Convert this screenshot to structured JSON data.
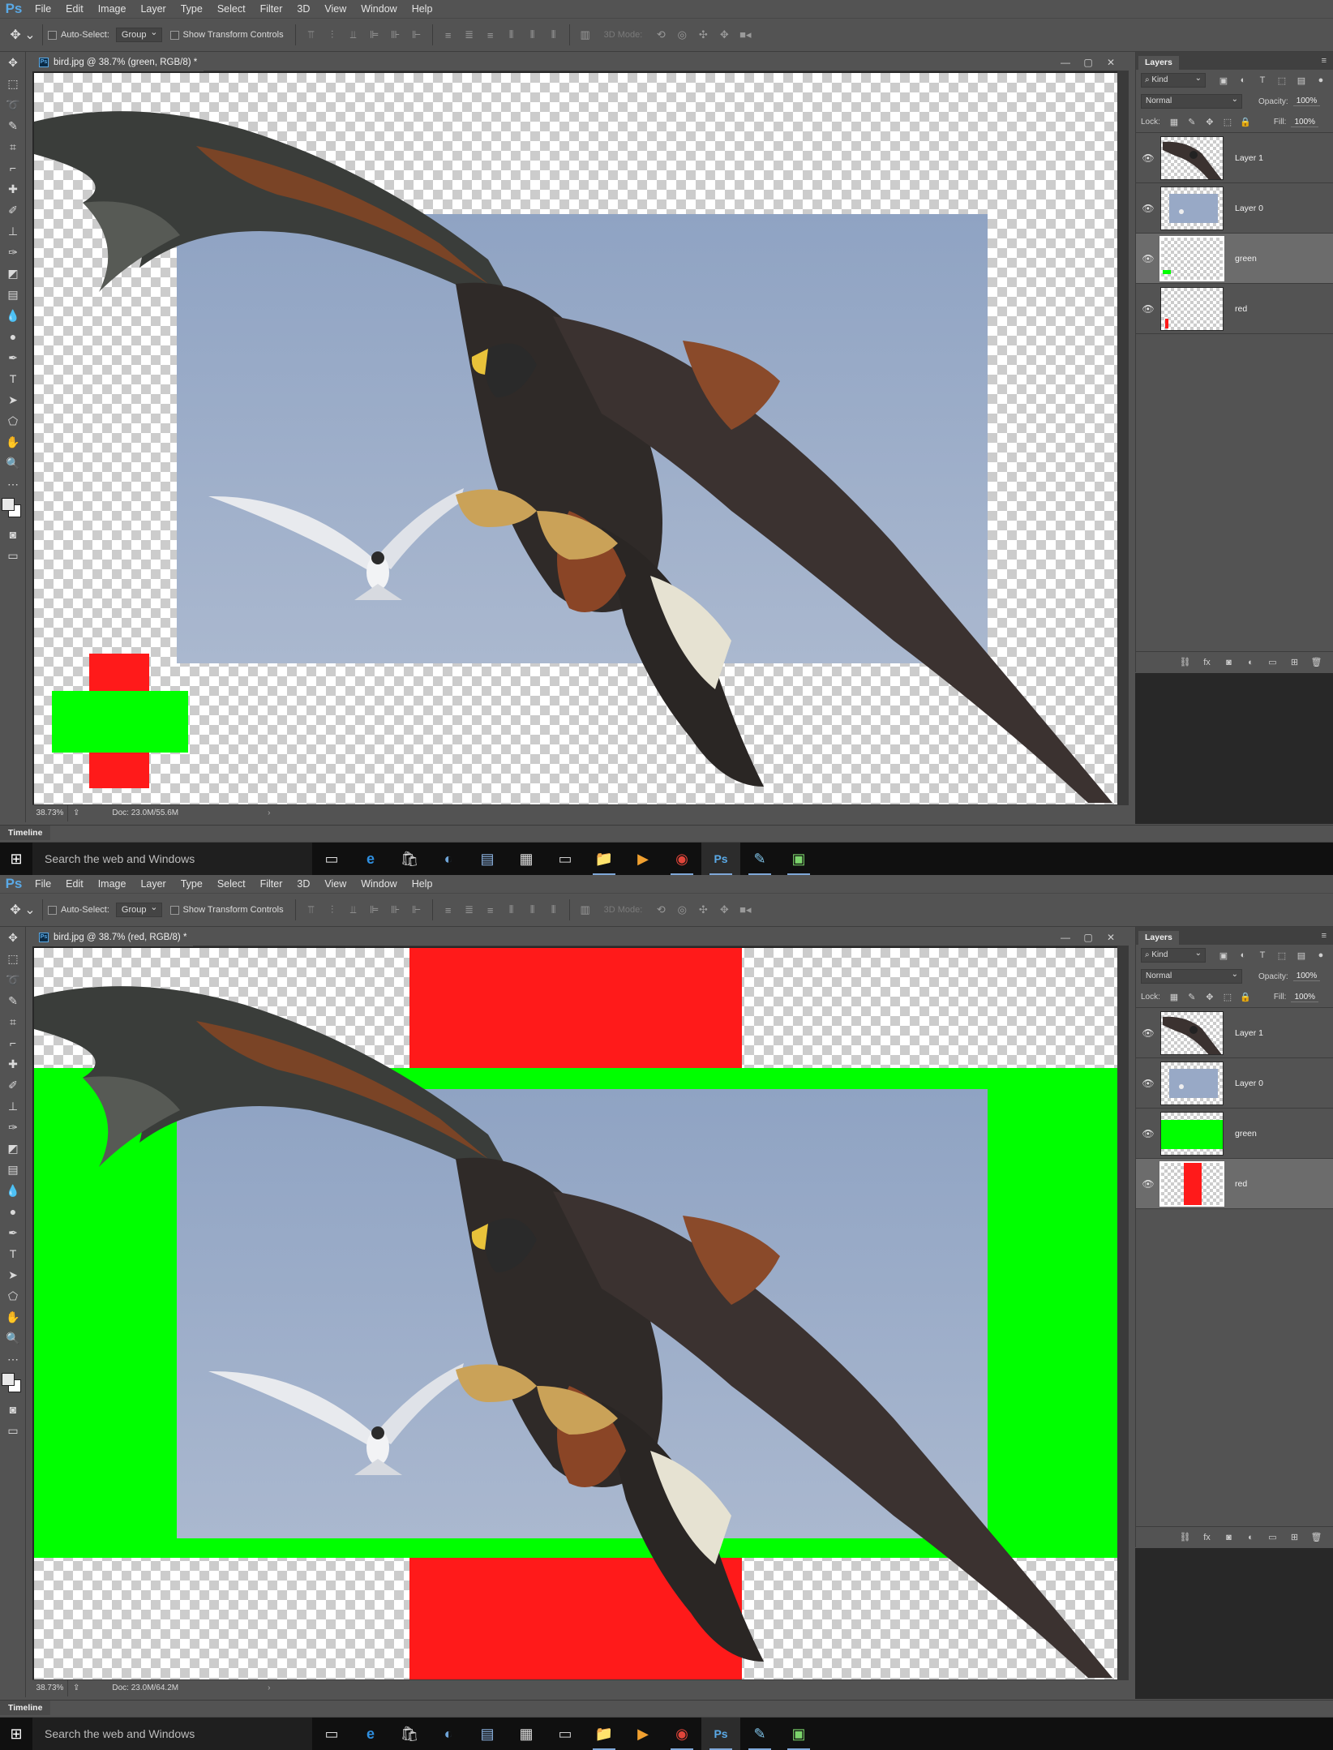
{
  "app": {
    "logo": "Ps"
  },
  "menus": [
    "File",
    "Edit",
    "Image",
    "Layer",
    "Type",
    "Select",
    "Filter",
    "3D",
    "View",
    "Window",
    "Help"
  ],
  "options": {
    "auto_select_label": "Auto-Select:",
    "group_value": "Group",
    "transform_label": "Show Transform Controls",
    "mode_3d": "3D Mode:"
  },
  "taskbar": {
    "search_placeholder": "Search the web and Windows"
  },
  "timeline_label": "Timeline",
  "layers_panel": {
    "tab": "Layers",
    "kind": "Kind",
    "blend_mode": "Normal",
    "opacity_label": "Opacity:",
    "fill_label": "Fill:",
    "lock_label": "Lock:"
  },
  "screens": [
    {
      "doc_title": "bird.jpg @ 38.7% (green, RGB/8) *",
      "zoom": "38.73%",
      "doc_info": "Doc: 23.0M/55.6M",
      "opacity": "100%",
      "fill": "100%",
      "selected_layer": "green",
      "layers": [
        {
          "name": "Layer 1",
          "visible": true
        },
        {
          "name": "Layer 0",
          "visible": true
        },
        {
          "name": "green",
          "visible": true
        },
        {
          "name": "red",
          "visible": true
        }
      ]
    },
    {
      "doc_title": "bird.jpg @ 38.7% (red, RGB/8) *",
      "zoom": "38.73%",
      "doc_info": "Doc: 23.0M/64.2M",
      "opacity": "100%",
      "fill": "100%",
      "selected_layer": "red",
      "layers": [
        {
          "name": "Layer 1",
          "visible": true
        },
        {
          "name": "Layer 0",
          "visible": true
        },
        {
          "name": "green",
          "visible": true
        },
        {
          "name": "red",
          "visible": true
        }
      ]
    }
  ],
  "colors": {
    "green": "#00ff00",
    "red": "#ff1a1a",
    "sky": "#98a9c6",
    "ps_bg": "#535353",
    "accent": "#5aa9e6"
  }
}
